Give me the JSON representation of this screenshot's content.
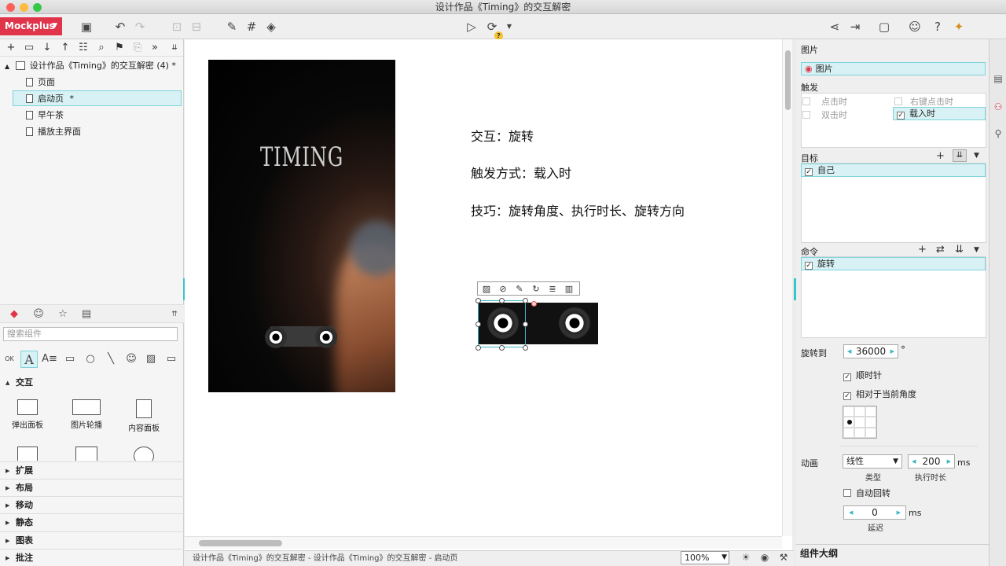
{
  "window": {
    "title": "设计作品《Timing》的交互解密"
  },
  "toolbar": {
    "brand": "Mockplus",
    "help_badge": "?"
  },
  "left_panel": {
    "project": {
      "name": "设计作品《Timing》的交互解密 (4)",
      "modified_mark": "*"
    },
    "pages": [
      {
        "label": "页面",
        "modified": ""
      },
      {
        "label": "启动页",
        "modified": "*"
      },
      {
        "label": "早午茶",
        "modified": ""
      },
      {
        "label": "播放主界面",
        "modified": ""
      }
    ],
    "search_placeholder": "搜索组件",
    "sections": [
      {
        "label": "交互",
        "expanded": true
      },
      {
        "label": "扩展"
      },
      {
        "label": "布局"
      },
      {
        "label": "移动"
      },
      {
        "label": "静态"
      },
      {
        "label": "图表"
      },
      {
        "label": "批注"
      }
    ],
    "components": [
      {
        "label": "弹出面板"
      },
      {
        "label": "图片轮播"
      },
      {
        "label": "内容面板"
      }
    ]
  },
  "canvas": {
    "phone": {
      "logo_text": "TIMING"
    },
    "description": [
      "交互：旋转",
      "触发方式：载入时",
      "技巧：旋转角度、执行时长、旋转方向"
    ]
  },
  "status_bar": {
    "path": "设计作品《Timing》的交互解密 - 设计作品《Timing》的交互解密 - 启动页",
    "zoom": "100%"
  },
  "right_panel": {
    "component_header": "图片",
    "component_name": "图片",
    "trigger_header": "触发",
    "triggers": [
      {
        "label": "点击时",
        "checked": false,
        "enabled": false
      },
      {
        "label": "右键点击时",
        "checked": false,
        "enabled": false
      },
      {
        "label": "双击时",
        "checked": false,
        "enabled": false
      },
      {
        "label": "载入时",
        "checked": true,
        "enabled": true
      }
    ],
    "target_header": "目标",
    "targets": [
      {
        "label": "自己",
        "checked": true
      }
    ],
    "command_header": "命令",
    "commands": [
      {
        "label": "旋转",
        "checked": true
      }
    ],
    "rotate_to_label": "旋转到",
    "rotate_value": "36000",
    "degree_unit": "°",
    "clockwise_label": "顺时针",
    "clockwise": true,
    "relative_label": "相对于当前角度",
    "relative": true,
    "animation_label": "动画",
    "animation_type": "线性",
    "animation_type_caption": "类型",
    "duration_value": "200",
    "duration_unit": "ms",
    "duration_caption": "执行时长",
    "auto_revert_label": "自动回转",
    "auto_revert": false,
    "delay_value": "0",
    "delay_unit": "ms",
    "delay_caption": "延迟",
    "outline_header": "组件大纲"
  },
  "colors": {
    "brand": "#e0344a",
    "accent": "#38b8c4",
    "selection_bg": "#d7f1f4"
  }
}
